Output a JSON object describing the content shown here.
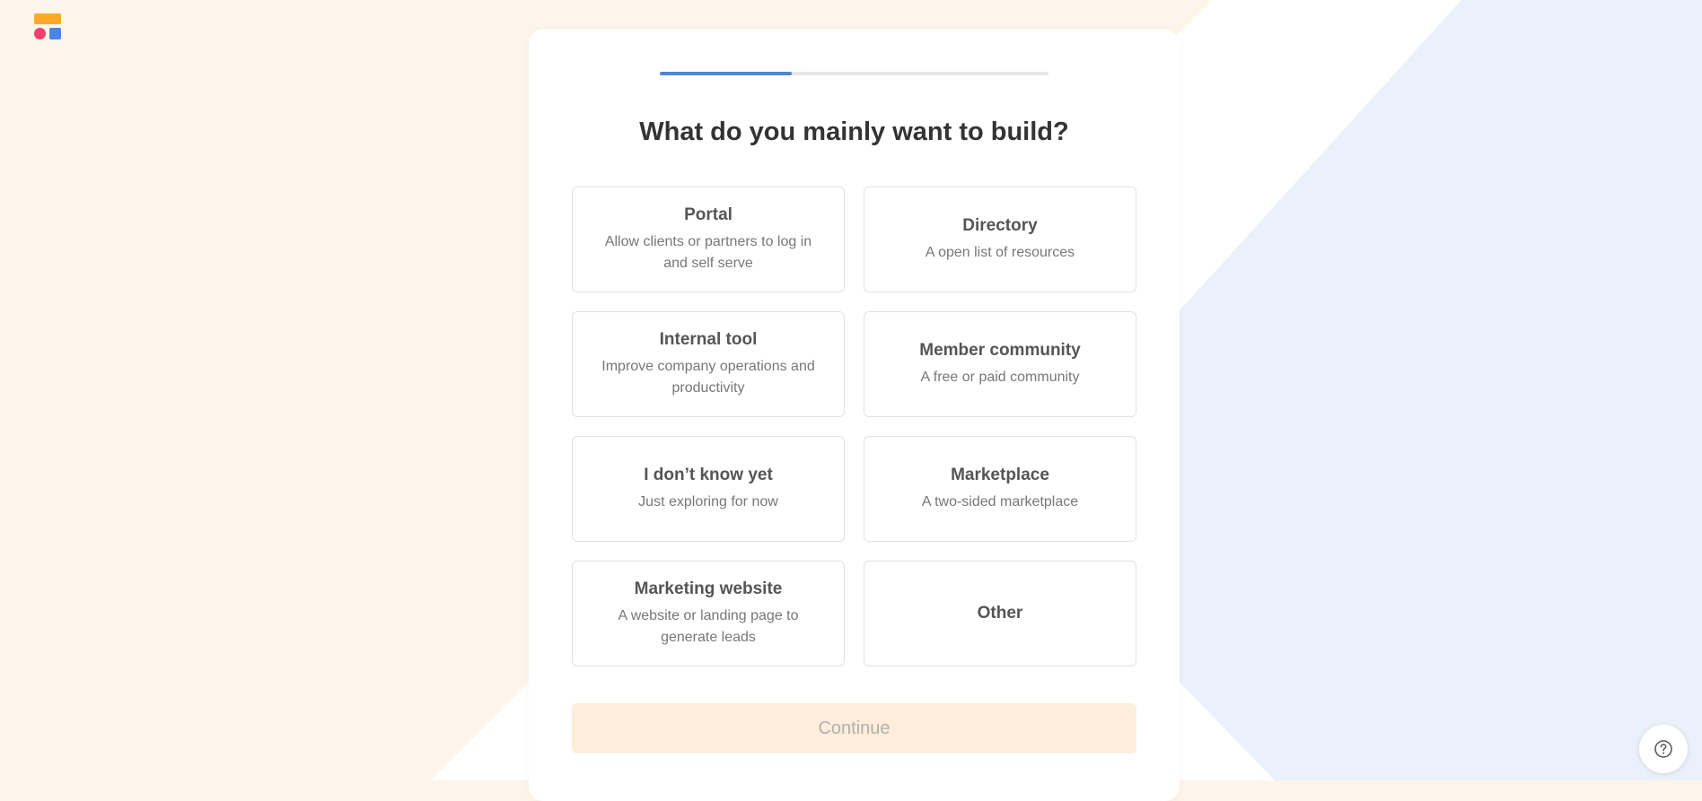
{
  "colors": {
    "background_warm": "#fdf5e9",
    "background_cool": "#eaf1fa",
    "accent": "#4a86d9",
    "continue_bg": "#fdeddb",
    "continue_text": "#b3b0ab"
  },
  "logo": {
    "icon": "app-logo-icon"
  },
  "progress": {
    "fraction": 0.34
  },
  "title": "What do you mainly want to build?",
  "options": [
    {
      "title": "Portal",
      "description": "Allow clients or partners to log in and self serve"
    },
    {
      "title": "Directory",
      "description": "A open list of resources"
    },
    {
      "title": "Internal tool",
      "description": "Improve company operations and productivity"
    },
    {
      "title": "Member community",
      "description": "A free or paid community"
    },
    {
      "title": "I don’t know yet",
      "description": "Just exploring for now"
    },
    {
      "title": "Marketplace",
      "description": "A two-sided marketplace"
    },
    {
      "title": "Marketing website",
      "description": "A website or landing page to generate leads"
    },
    {
      "title": "Other",
      "description": ""
    }
  ],
  "continue_label": "Continue",
  "help": {
    "icon": "help-icon"
  }
}
